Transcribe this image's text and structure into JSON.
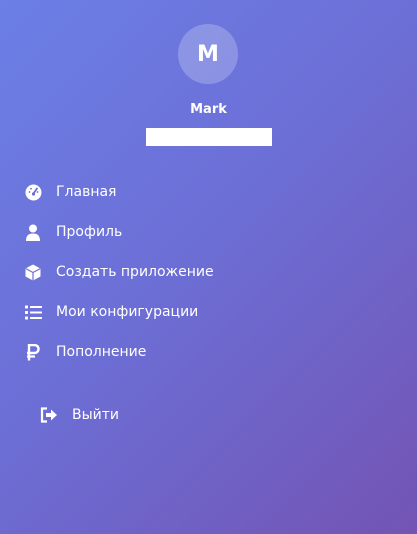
{
  "user": {
    "avatar_initial": "M",
    "name": "Mark"
  },
  "menu": {
    "items": [
      {
        "label": "Главная",
        "icon": "dashboard-icon"
      },
      {
        "label": "Профиль",
        "icon": "user-icon"
      },
      {
        "label": "Создать приложение",
        "icon": "cube-icon"
      },
      {
        "label": "Мои конфигурации",
        "icon": "list-icon"
      },
      {
        "label": "Пополнение",
        "icon": "ruble-icon"
      }
    ],
    "logout_label": "Выйти"
  },
  "colors": {
    "gradient_start": "#6b7fe6",
    "gradient_end": "#7354b4",
    "text": "#ffffff"
  }
}
